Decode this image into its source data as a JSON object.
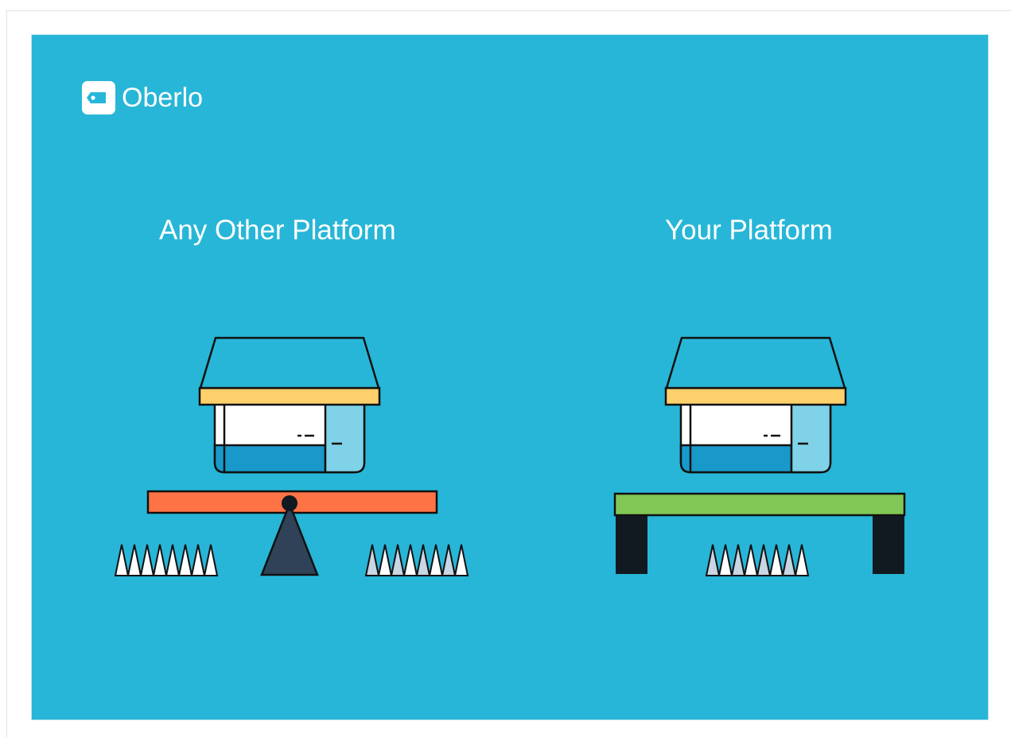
{
  "brand": {
    "name": "Oberlo",
    "icon": "tag-icon"
  },
  "columns": [
    {
      "title": "Any Other Platform"
    },
    {
      "title": "Your Platform"
    }
  ],
  "colors": {
    "background": "#27b6d7",
    "roof": "#27b6d7",
    "awning": "#fed06b",
    "seesaw_plank": "#fe7346",
    "seesaw_fulcrum": "#2f4258",
    "table_top": "#81c755",
    "table_legs": "#121a21",
    "outline": "#111111"
  }
}
